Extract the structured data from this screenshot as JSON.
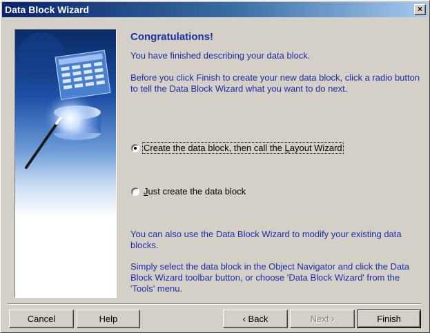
{
  "window": {
    "title": "Data Block Wizard",
    "close_label": "×"
  },
  "content": {
    "heading": "Congratulations!",
    "intro": "You have finished describing your data block.",
    "instructions": "Before you click Finish to create your new data block, click a radio button to tell the Data Block Wizard what you want to do next.",
    "options": [
      {
        "pre": "Create the data block, then call the ",
        "mnemonic": "L",
        "post": "ayout Wizard",
        "selected": true
      },
      {
        "pre": "",
        "mnemonic": "J",
        "post": "ust create the data block",
        "selected": false
      }
    ],
    "modify_note": "You can also use the Data Block Wizard to modify your existing data blocks.",
    "select_note": "Simply select the data block in the Object Navigator and click the Data Block Wizard toolbar button, or choose 'Data Block Wizard' from the 'Tools' menu."
  },
  "buttons": {
    "cancel": "Cancel",
    "help": "Help",
    "back": "‹ Back",
    "next": "Next ›",
    "finish": "Finish"
  },
  "colors": {
    "text_blue": "#1a2fa6",
    "titlebar_start": "#0a246a",
    "face": "#d4d0c8"
  }
}
